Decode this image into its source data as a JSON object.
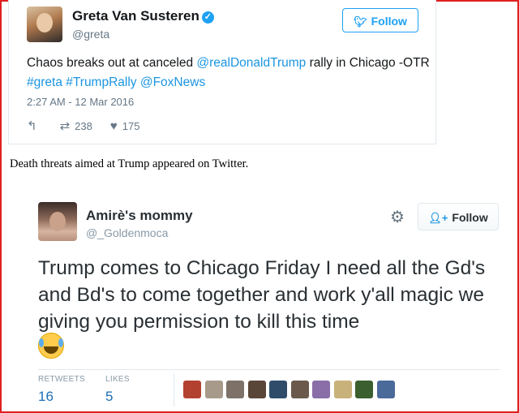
{
  "tweet1": {
    "name": "Greta Van Susteren",
    "verified_glyph": "✓",
    "handle": "@greta",
    "follow_label": "Follow",
    "text_plain1": "Chaos breaks out at canceled ",
    "mention1": "@realDonaldTrump",
    "text_plain2": " rally in Chicago -OTR ",
    "hashtag1": "#greta",
    "hashtag2": "#TrumpRally",
    "mention2": "@FoxNews",
    "timestamp": "2:27 AM - 12 Mar 2016",
    "retweets": "238",
    "likes": "175",
    "icons": {
      "reply": "reply-icon",
      "retweet": "retweet-icon",
      "like": "heart-icon",
      "bird": "twitter-bird-icon"
    }
  },
  "caption": "Death threats aimed at Trump appeared on Twitter.",
  "tweet2": {
    "name": "Amirè's mommy",
    "handle": "@_Goldenmoca",
    "follow_label": "Follow",
    "text": "Trump comes to Chicago Friday I need all the Gd's and Bd's to come together and work y'all magic we giving you permission to kill this time",
    "retweets_label": "RETWEETS",
    "retweets": "16",
    "likes_label": "LIKES",
    "likes": "5",
    "icons": {
      "settings": "gear-icon",
      "follow": "add-user-icon",
      "emoji": "tears-of-joy-emoji"
    },
    "liker_avatar_colors": [
      "#b3412f",
      "#a89a8a",
      "#7d7168",
      "#5a4638",
      "#2f4d6b",
      "#6b5a4c",
      "#8a6ea8",
      "#c9b27a",
      "#3b5f2e",
      "#4a6a9a"
    ]
  },
  "colors": {
    "accent": "#1da1f2",
    "link": "#1b95e0",
    "frame": "#e02020"
  }
}
